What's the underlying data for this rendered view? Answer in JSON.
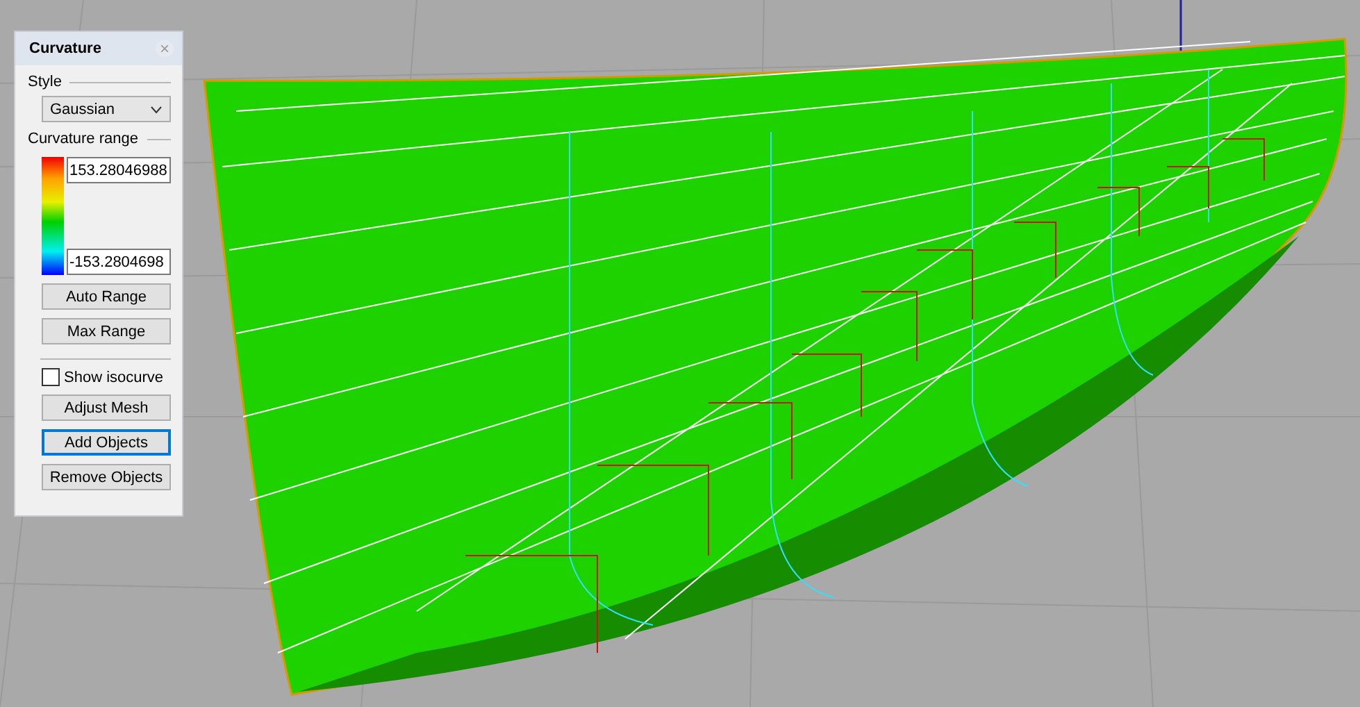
{
  "panel": {
    "title": "Curvature",
    "close": "×",
    "style_label": "Style",
    "style_value": "Gaussian",
    "range_label": "Curvature range",
    "range_max": "153.28046988",
    "range_min": "-153.2804698",
    "range_buttons": [
      {
        "label": "Auto Range",
        "focused": false
      },
      {
        "label": "Max Range",
        "focused": false
      }
    ],
    "isocurve": {
      "label": "Show isocurve",
      "checked": false
    },
    "buttons": [
      {
        "label": "Adjust Mesh",
        "focused": false
      },
      {
        "label": "Add Objects",
        "focused": true
      },
      {
        "label": "Remove Objects",
        "focused": false
      }
    ]
  }
}
